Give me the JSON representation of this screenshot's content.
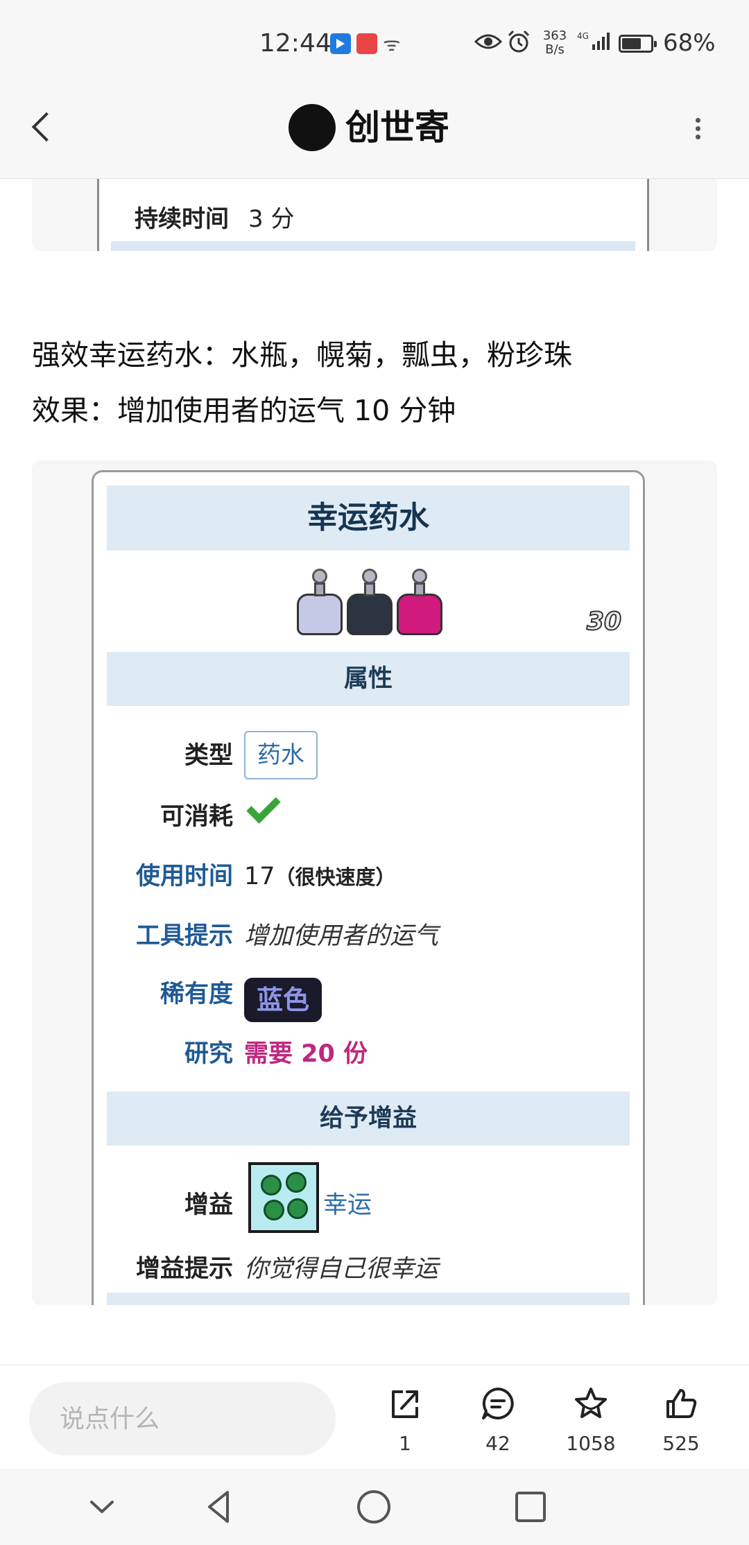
{
  "status_bar": {
    "time": "12:44",
    "net_speed_value": "363",
    "net_speed_unit": "B/s",
    "network": "4G",
    "battery_level": 0.68,
    "battery_text": "68%"
  },
  "header": {
    "title": "创世寄",
    "back_icon": "chevron-left-icon",
    "more_icon": "more-vertical-icon"
  },
  "prev_card": {
    "label": "持续时间",
    "value": "3 分"
  },
  "recipe": {
    "line1": "强效幸运药水：水瓶，幌菊，瓢虫，粉珍珠",
    "line2": "效果：增加使用者的运气 10 分钟"
  },
  "infobox": {
    "title": "幸运药水",
    "stack_count": "30",
    "section_properties": "属性",
    "type_label": "类型",
    "type_value": "药水",
    "consumable_label": "可消耗",
    "use_time_label": "使用时间",
    "use_time_value": "17",
    "use_time_note": "（很快速度）",
    "tooltip_label": "工具提示",
    "tooltip_value": "增加使用者的运气",
    "rarity_label": "稀有度",
    "rarity_value": "蓝色",
    "research_label": "研究",
    "research_value": "需要 20 份",
    "section_buff": "给予增益",
    "buff_label": "增益",
    "buff_value": "幸运",
    "buff_tip_label": "增益提示",
    "buff_tip_value": "你觉得自己很幸运"
  },
  "action_bar": {
    "comment_placeholder": "说点什么",
    "share_count": "1",
    "comment_count": "42",
    "favorite_count": "1058",
    "like_count": "525"
  },
  "colors": {
    "band": "#deebf5",
    "link": "#1f5a96",
    "research": "#c0267f",
    "check": "#3aa43a"
  }
}
